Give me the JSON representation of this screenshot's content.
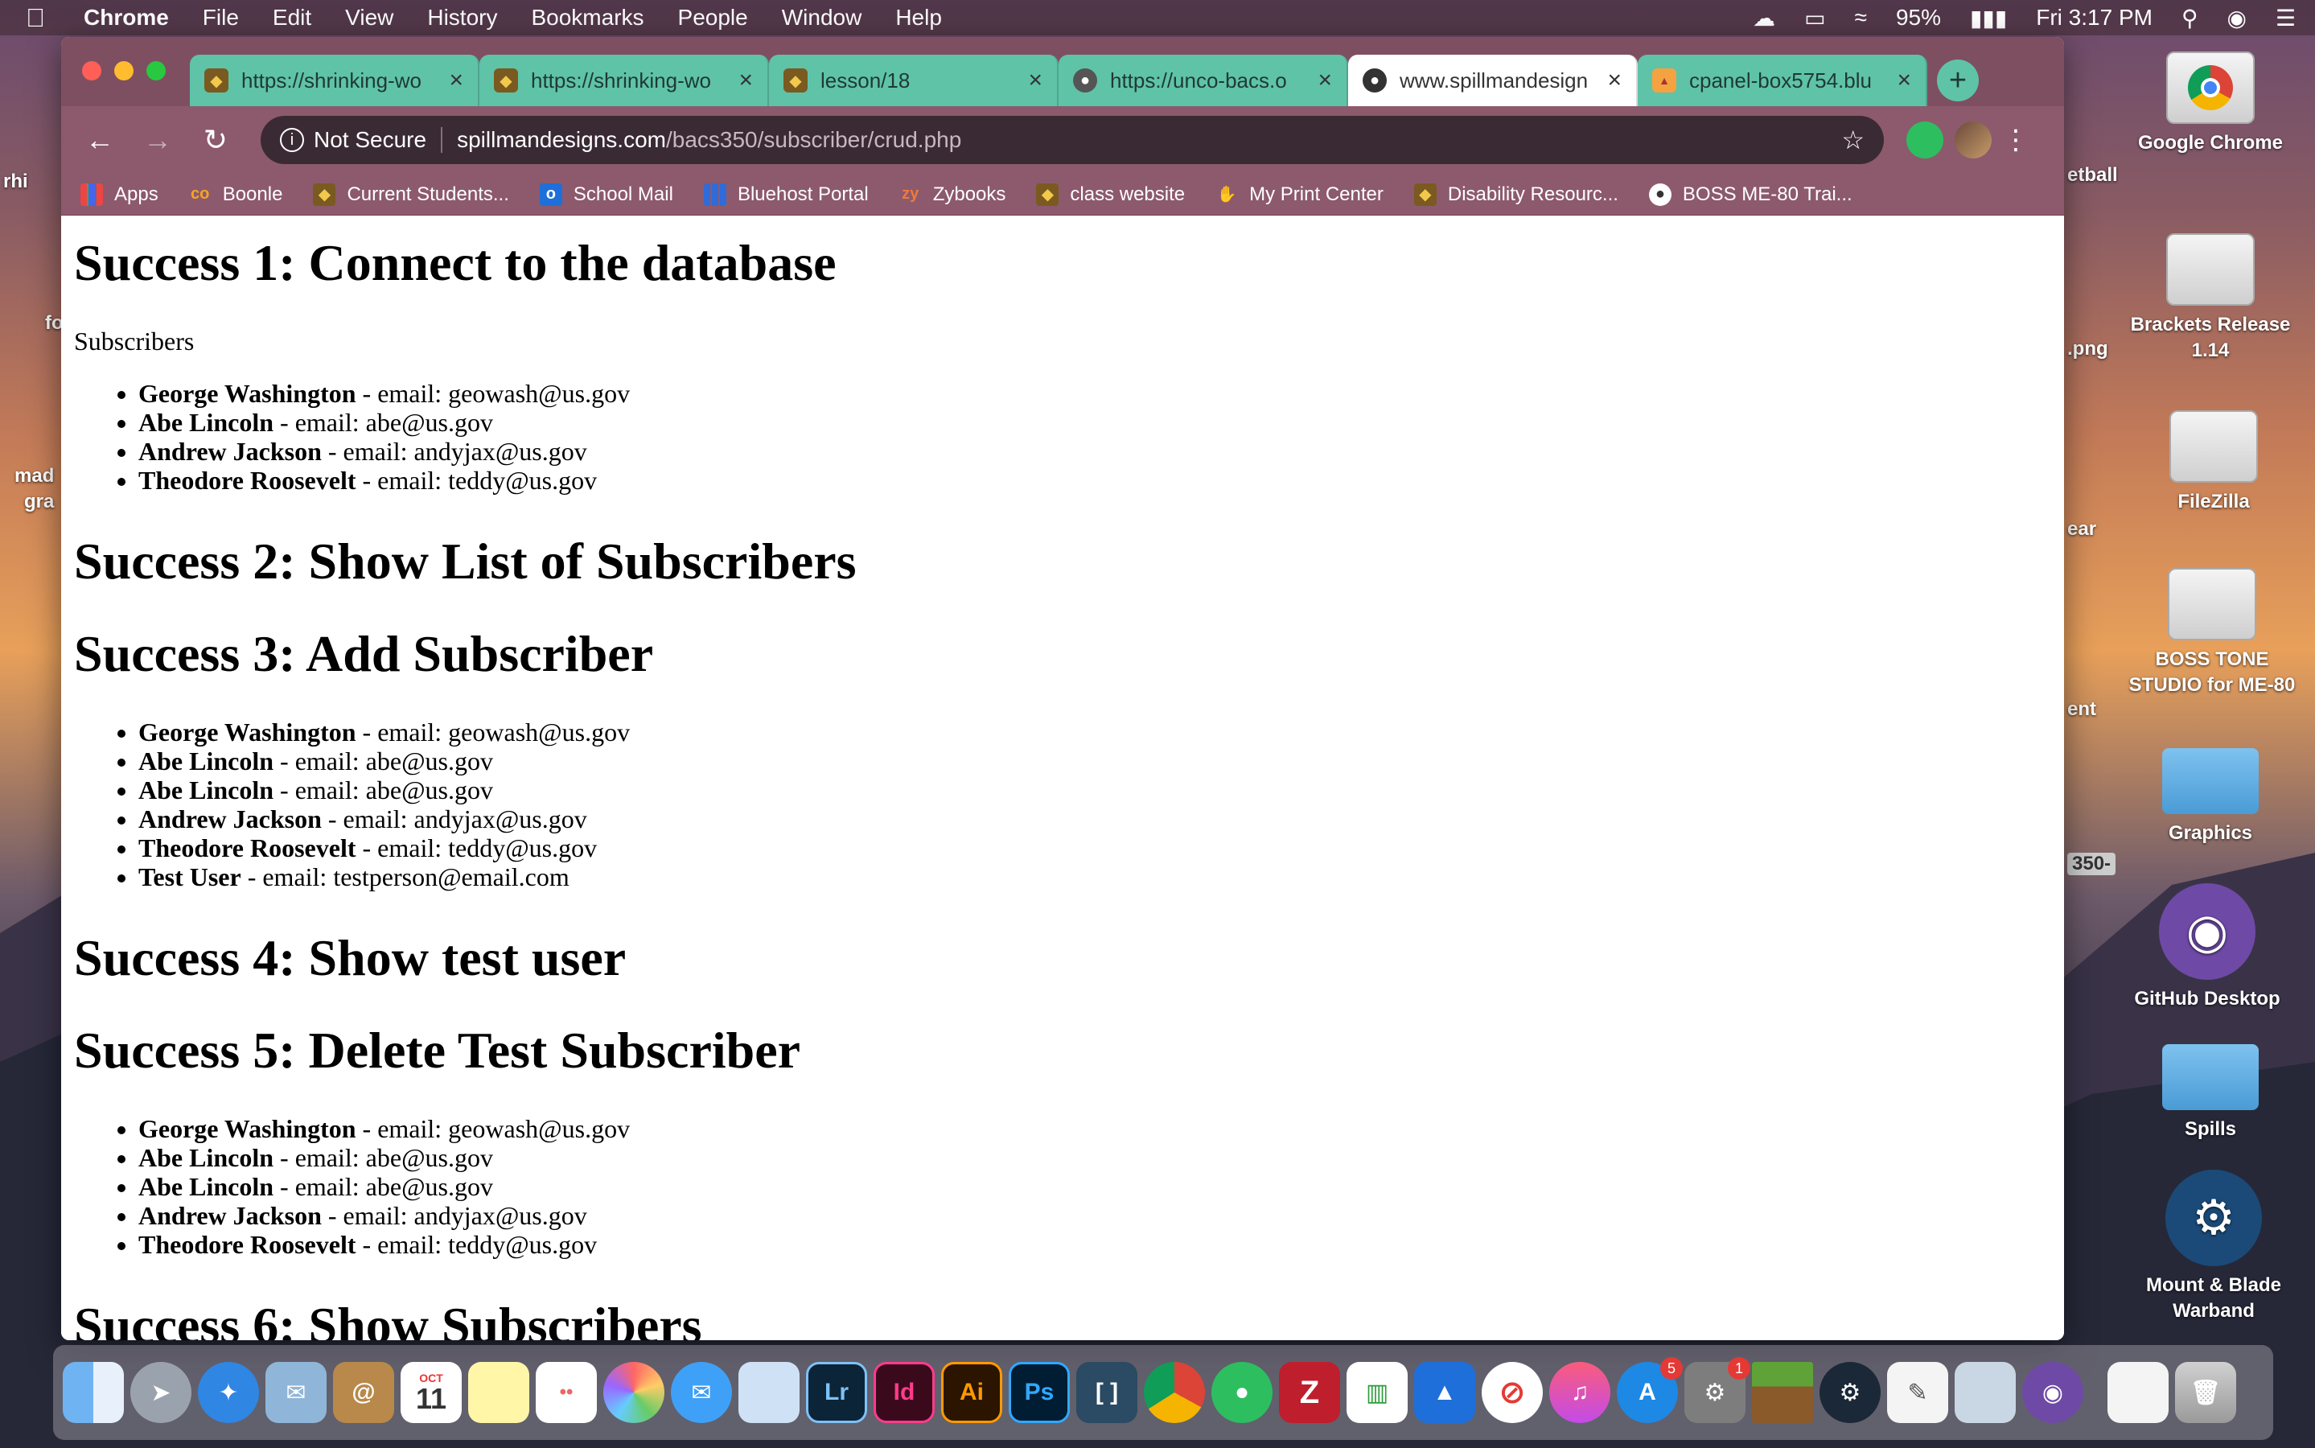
{
  "menubar": {
    "app": "Chrome",
    "items": [
      "File",
      "Edit",
      "View",
      "History",
      "Bookmarks",
      "People",
      "Window",
      "Help"
    ],
    "battery": "95%",
    "clock": "Fri 3:17 PM"
  },
  "desktop": {
    "icons": [
      {
        "label": "Google Chrome"
      },
      {
        "label": "Brackets Release 1.14"
      },
      {
        "label": "FileZilla"
      },
      {
        "label": "BOSS TONE STUDIO for ME-80"
      },
      {
        "label": "Graphics"
      },
      {
        "label": "GitHub Desktop"
      },
      {
        "label": "Spills"
      },
      {
        "label": "Mount & Blade Warband"
      }
    ],
    "peek_left": [
      "rhi",
      "fo",
      "mad",
      "gra"
    ],
    "peek_right": [
      "etball",
      ".png",
      "ear",
      "ent",
      "350-"
    ]
  },
  "browser": {
    "tabs": [
      {
        "title": "https://shrinking-wo"
      },
      {
        "title": "https://shrinking-wo"
      },
      {
        "title": "lesson/18"
      },
      {
        "title": "https://unco-bacs.o"
      },
      {
        "title": "www.spillmandesign"
      },
      {
        "title": "cpanel-box5754.blu"
      }
    ],
    "security": "Not Secure",
    "url_host": "spillmandesigns.com",
    "url_path": "/bacs350/subscriber/crud.php",
    "bookmarks": [
      {
        "label": "Apps"
      },
      {
        "label": "Boonle"
      },
      {
        "label": "Current Students..."
      },
      {
        "label": "School Mail"
      },
      {
        "label": "Bluehost Portal"
      },
      {
        "label": "Zybooks"
      },
      {
        "label": "class website"
      },
      {
        "label": "My Print Center"
      },
      {
        "label": "Disability Resourc..."
      },
      {
        "label": "BOSS ME-80 Trai..."
      }
    ]
  },
  "page": {
    "s1": "Success 1: Connect to the database",
    "subscribers_label": "Subscribers",
    "list1": [
      {
        "name": "George Washington",
        "rest": " - email: geowash@us.gov"
      },
      {
        "name": "Abe Lincoln",
        "rest": " - email: abe@us.gov"
      },
      {
        "name": "Andrew Jackson",
        "rest": " - email: andyjax@us.gov"
      },
      {
        "name": "Theodore Roosevelt",
        "rest": " - email: teddy@us.gov"
      }
    ],
    "s2": "Success 2: Show List of Subscribers",
    "s3": "Success 3: Add Subscriber",
    "list2": [
      {
        "name": "George Washington",
        "rest": " - email: geowash@us.gov"
      },
      {
        "name": "Abe Lincoln",
        "rest": " - email: abe@us.gov"
      },
      {
        "name": "Abe Lincoln",
        "rest": " - email: abe@us.gov"
      },
      {
        "name": "Andrew Jackson",
        "rest": " - email: andyjax@us.gov"
      },
      {
        "name": "Theodore Roosevelt",
        "rest": " - email: teddy@us.gov"
      },
      {
        "name": "Test User",
        "rest": " - email: testperson@email.com"
      }
    ],
    "s4": "Success 4: Show test user",
    "s5": "Success 5: Delete Test Subscriber",
    "list3": [
      {
        "name": "George Washington",
        "rest": " - email: geowash@us.gov"
      },
      {
        "name": "Abe Lincoln",
        "rest": " - email: abe@us.gov"
      },
      {
        "name": "Abe Lincoln",
        "rest": " - email: abe@us.gov"
      },
      {
        "name": "Andrew Jackson",
        "rest": " - email: andyjax@us.gov"
      },
      {
        "name": "Theodore Roosevelt",
        "rest": " - email: teddy@us.gov"
      }
    ],
    "s6": "Success 6: Show Subscribers"
  },
  "dock": {
    "apps": [
      "finder-icon",
      "launchpad-icon",
      "safari-icon",
      "mail-icon",
      "contacts-icon",
      "calendar-icon",
      "notes-icon",
      "reminders-icon",
      "photos-icon",
      "messages-icon",
      "preview-icon",
      "lightroom-icon",
      "indesign-icon",
      "illustrator-icon",
      "photoshop-icon",
      "brackets-icon",
      "chrome-icon",
      "evernote-icon",
      "filezilla-icon",
      "numbers-icon",
      "keynote-icon",
      "news-icon",
      "itunes-icon",
      "appstore-icon",
      "sysprefs-icon",
      "minecraft-icon",
      "steam-icon",
      "textedit-icon",
      "imagecapture-icon",
      "github-icon",
      "document-icon",
      "trash-icon"
    ],
    "calendar_month": "OCT",
    "calendar_day": "11",
    "appstore_badge": "5",
    "sysprefs_badge": "1",
    "labels": {
      "lr": "Lr",
      "id": "Id",
      "ai": "Ai",
      "ps": "Ps"
    }
  }
}
